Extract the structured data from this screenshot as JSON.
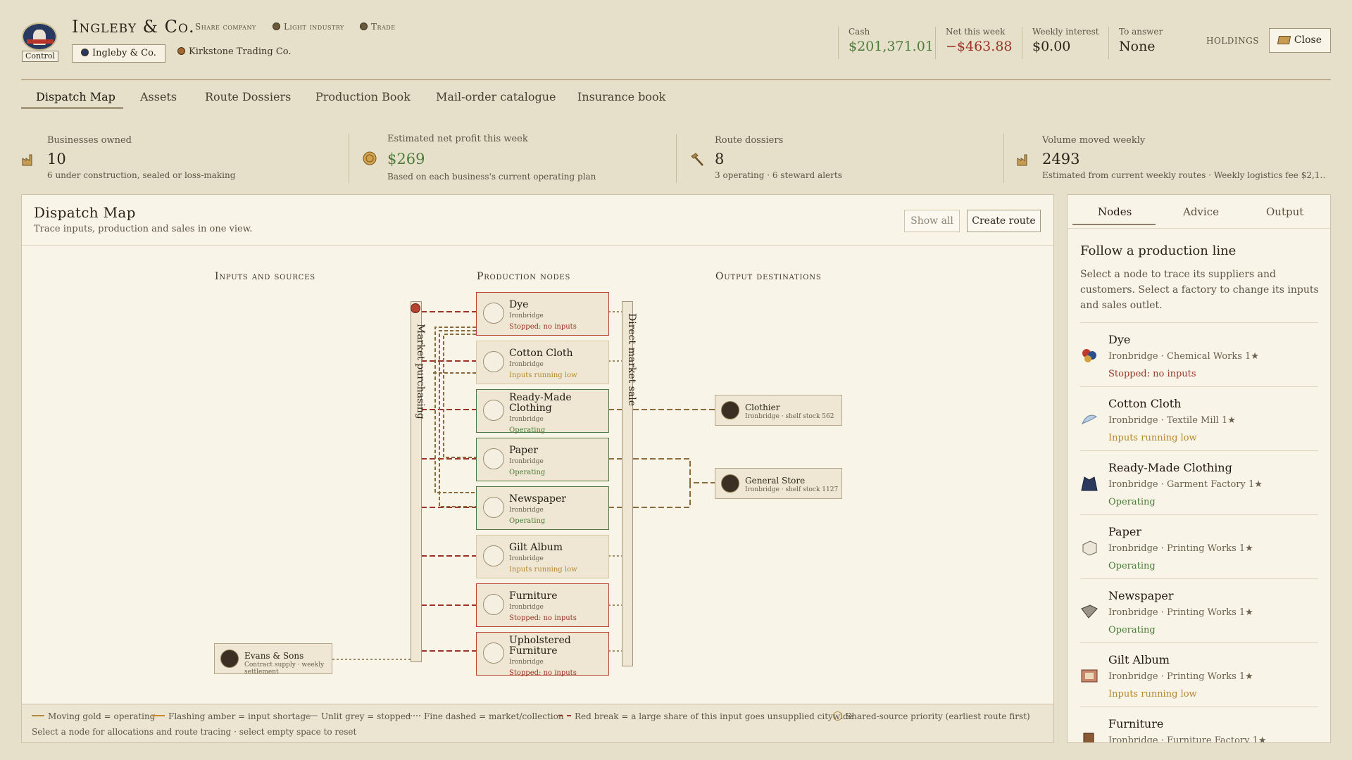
{
  "header": {
    "control_label": "Control",
    "company_name": "Ingleby & Co.",
    "tags": [
      "Share company",
      "Light industry",
      "Trade"
    ],
    "selected_company": "Ingleby & Co.",
    "other_company": "Kirkstone Trading Co.",
    "stats": [
      {
        "label": "Cash",
        "value": "$201,371.01"
      },
      {
        "label": "Net this week",
        "value": "−$463.88"
      },
      {
        "label": "Weekly interest",
        "value": "$0.00"
      },
      {
        "label": "To answer",
        "value": "None"
      }
    ],
    "holdings_label": "HOLDINGS",
    "close_label": "Close"
  },
  "tabs": [
    "Dispatch Map",
    "Assets",
    "Route Dossiers",
    "Production Book",
    "Mail-order catalogue",
    "Insurance book"
  ],
  "summary": [
    {
      "label": "Businesses owned",
      "value": "10",
      "sub": "6 under construction, sealed or loss-making",
      "icon": "factory-icon"
    },
    {
      "label": "Estimated net profit this week",
      "value": "$269",
      "sub": "Based on each business's current operating plan",
      "icon": "coin-icon"
    },
    {
      "label": "Route dossiers",
      "value": "8",
      "sub": "3 operating · 6 steward alerts",
      "icon": "hammer-icon"
    },
    {
      "label": "Volume moved weekly",
      "value": "2493",
      "sub": "Estimated from current weekly routes · Weekly logistics fee $2,1…",
      "icon": "factory-icon"
    }
  ],
  "map": {
    "title": "Dispatch Map",
    "subtitle": "Trace inputs, production and sales in one view.",
    "show_all": "Show all",
    "create_route": "Create route",
    "col_inputs": "Inputs and sources",
    "col_production": "Production nodes",
    "col_outputs": "Output destinations",
    "market_purchasing": "Market purchasing",
    "direct_market_sale": "Direct market sale",
    "nodes": [
      {
        "name": "Dye",
        "city": "Ironbridge",
        "status": "Stopped: no inputs",
        "state": "red"
      },
      {
        "name": "Cotton Cloth",
        "city": "Ironbridge",
        "status": "Inputs running low",
        "state": "amber"
      },
      {
        "name": "Ready-Made Clothing",
        "city": "Ironbridge",
        "status": "Operating",
        "state": "green"
      },
      {
        "name": "Paper",
        "city": "Ironbridge",
        "status": "Operating",
        "state": "green"
      },
      {
        "name": "Newspaper",
        "city": "Ironbridge",
        "status": "Operating",
        "state": "green"
      },
      {
        "name": "Gilt Album",
        "city": "Ironbridge",
        "status": "Inputs running low",
        "state": "amber"
      },
      {
        "name": "Furniture",
        "city": "Ironbridge",
        "status": "Stopped: no inputs",
        "state": "red"
      },
      {
        "name": "Upholstered Furniture",
        "city": "Ironbridge",
        "status": "Stopped: no inputs",
        "state": "red"
      }
    ],
    "destinations": [
      {
        "name": "Clothier",
        "sub": "Ironbridge · shelf stock 562"
      },
      {
        "name": "General Store",
        "sub": "Ironbridge · shelf stock 1127"
      }
    ],
    "source": {
      "name": "Evans & Sons",
      "sub": "Contract supply · weekly settlement"
    }
  },
  "legend": {
    "items": [
      {
        "text": "Moving gold = operating",
        "color": "#b08a3e"
      },
      {
        "text": "Flashing amber = input shortage",
        "color": "#c98a2c"
      },
      {
        "text": "Unlit grey = stopped",
        "color": "#b9b2a2"
      },
      {
        "text": "Fine dashed = market/collection",
        "color": "#8e8574"
      },
      {
        "text": "Red break = a large share of this input goes unsupplied citywide",
        "color": "#9b3427"
      },
      {
        "text": "Shared-source priority (earliest route first)",
        "color": "#b08a3e"
      }
    ],
    "hint": "Select a node for allocations and route tracing · select empty space to reset"
  },
  "side": {
    "tabs": [
      "Nodes",
      "Advice",
      "Output"
    ],
    "heading": "Follow a production line",
    "description": "Select a node to trace its suppliers and customers. Select a factory to change its inputs and sales outlet.",
    "items": [
      {
        "name": "Dye",
        "meta": "Ironbridge · Chemical Works 1★",
        "status": "Stopped: no inputs",
        "state": "red"
      },
      {
        "name": "Cotton Cloth",
        "meta": "Ironbridge · Textile Mill 1★",
        "status": "Inputs running low",
        "state": "amber"
      },
      {
        "name": "Ready-Made Clothing",
        "meta": "Ironbridge · Garment Factory 1★",
        "status": "Operating",
        "state": "green"
      },
      {
        "name": "Paper",
        "meta": "Ironbridge · Printing Works 1★",
        "status": "Operating",
        "state": "green"
      },
      {
        "name": "Newspaper",
        "meta": "Ironbridge · Printing Works 1★",
        "status": "Operating",
        "state": "green"
      },
      {
        "name": "Gilt Album",
        "meta": "Ironbridge · Printing Works 1★",
        "status": "Inputs running low",
        "state": "amber"
      },
      {
        "name": "Furniture",
        "meta": "Ironbridge · Furniture Factory 1★",
        "status": "",
        "state": "red"
      }
    ]
  },
  "colors": {
    "accent_green": "#4d7b39",
    "alert_red": "#9b3427",
    "amber": "#b6872f",
    "paper": "#f8f4e8"
  }
}
